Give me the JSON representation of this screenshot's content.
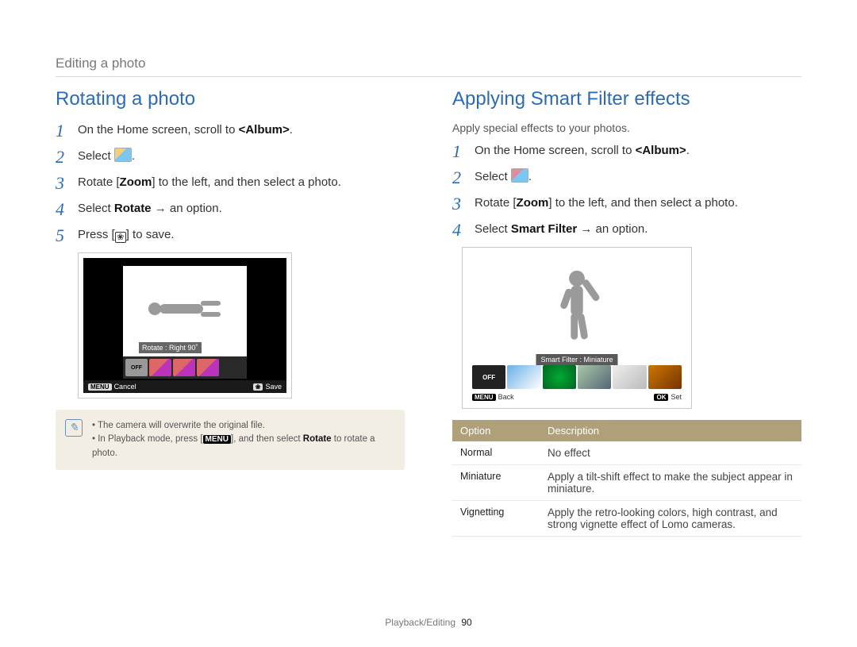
{
  "breadcrumb": "Editing a photo",
  "left": {
    "heading": "Rotating a photo",
    "steps": {
      "s1_pre": "On the Home screen, scroll to ",
      "s1_album": "<Album>",
      "s1_post": ".",
      "s2_pre": "Select ",
      "s2_post": ".",
      "s3_pre": "Rotate [",
      "s3_bold": "Zoom",
      "s3_post": "] to the left, and then select a photo.",
      "s4_pre": "Select ",
      "s4_bold": "Rotate",
      "s4_post": " → an option.",
      "s5_pre": "Press [",
      "s5_post": "] to save."
    },
    "screenshot": {
      "rotate_label": "Rotate : Right 90˚",
      "off_label": "OFF",
      "menu_label": "MENU",
      "cancel": "Cancel",
      "save": "Save",
      "flower_glyph": "❀"
    },
    "note": {
      "n1": "The camera will overwrite the original file.",
      "n2_pre": "In Playback mode, press [",
      "n2_menu": "MENU",
      "n2_mid": "], and then select ",
      "n2_bold": "Rotate",
      "n2_post": " to rotate a photo."
    }
  },
  "right": {
    "heading": "Applying Smart Filter effects",
    "intro": "Apply special effects to your photos.",
    "steps": {
      "s1_pre": "On the Home screen, scroll to ",
      "s1_album": "<Album>",
      "s1_post": ".",
      "s2_pre": "Select ",
      "s2_post": ".",
      "s3_pre": "Rotate [",
      "s3_bold": "Zoom",
      "s3_post": "] to the left, and then select a photo.",
      "s4_pre": "Select ",
      "s4_bold": "Smart Filter",
      "s4_post": " → an option."
    },
    "screenshot": {
      "sf_label": "Smart Filter : Miniature",
      "off_label": "OFF",
      "menu_label": "MENU",
      "back": "Back",
      "ok_label": "OK",
      "set": "Set"
    },
    "table": {
      "h_option": "Option",
      "h_desc": "Description",
      "rows": [
        {
          "option": "Normal",
          "desc": "No effect"
        },
        {
          "option": "Miniature",
          "desc": "Apply a tilt-shift effect to make the subject appear in miniature."
        },
        {
          "option": "Vignetting",
          "desc": "Apply the retro-looking colors, high contrast, and strong vignette effect of Lomo cameras."
        }
      ]
    }
  },
  "footer": {
    "section": "Playback/Editing",
    "page": "90"
  }
}
